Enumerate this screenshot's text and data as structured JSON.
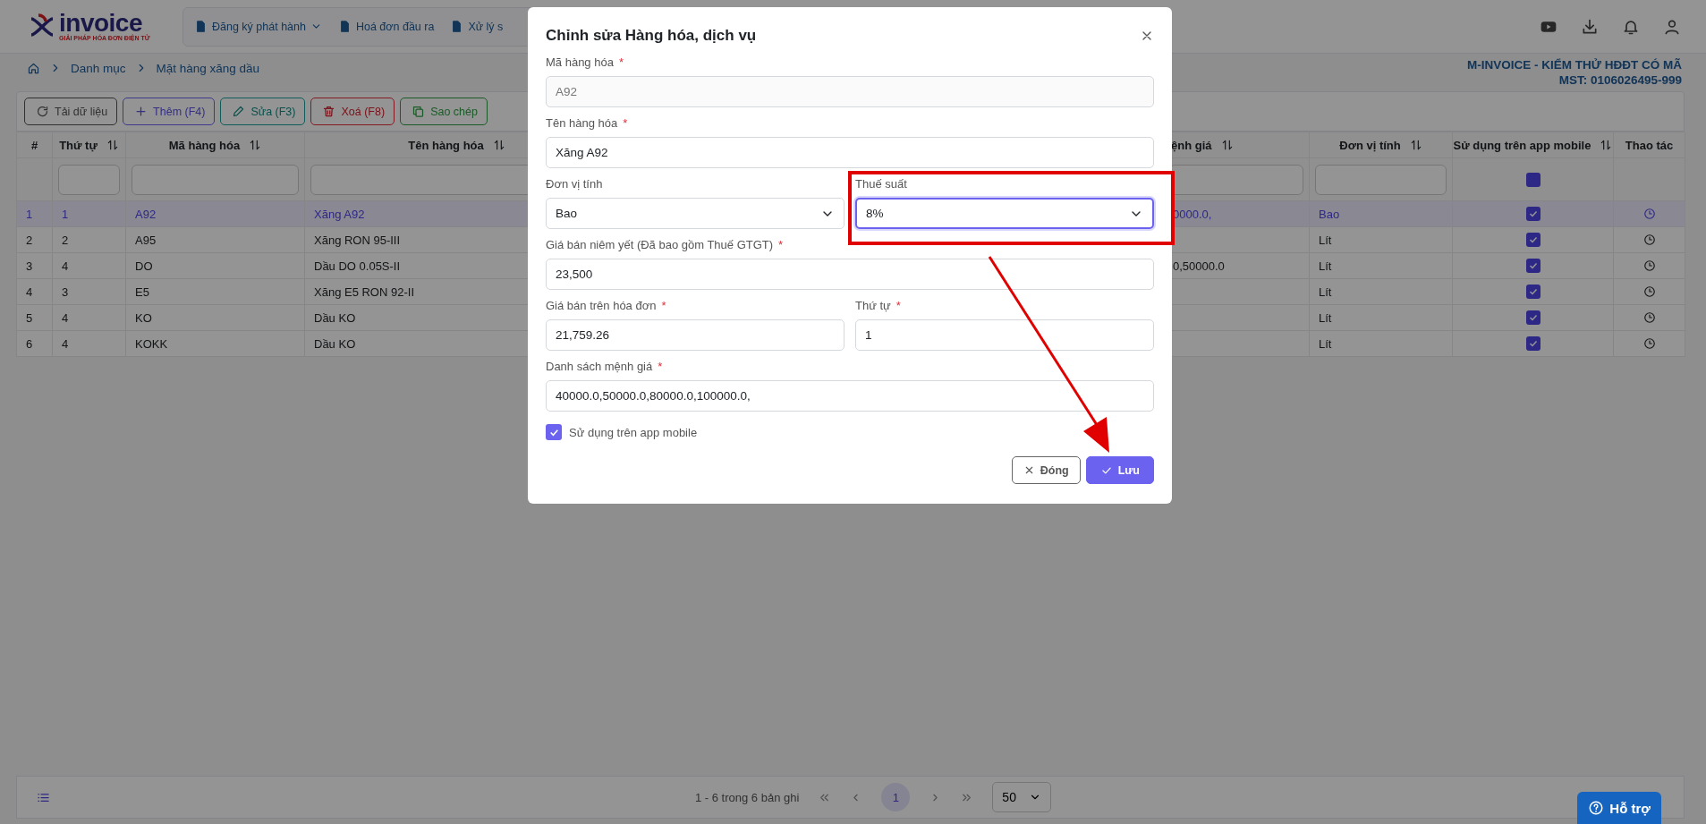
{
  "header": {
    "logo": {
      "text": "invoice",
      "tagline": "GIẢI PHÁP HÓA ĐƠN ĐIỆN TỬ"
    },
    "nav": [
      {
        "label": "Đăng ký phát hành",
        "dropdown": true
      },
      {
        "label": "Hoá đơn đầu ra",
        "dropdown": false
      },
      {
        "label": "Xử lý s",
        "dropdown": false
      }
    ]
  },
  "breadcrumb": [
    "Danh mục",
    "Mặt hàng xăng dầu"
  ],
  "company": {
    "name": "M-INVOICE - KIỂM THỬ HĐĐT CÓ MÃ",
    "tax_id": "MST: 0106026495-999"
  },
  "toolbar": [
    {
      "label": "Tải dữ liệu",
      "kind": "reload"
    },
    {
      "label": "Thêm (F4)",
      "kind": "add"
    },
    {
      "label": "Sửa (F3)",
      "kind": "edit"
    },
    {
      "label": "Xoá (F8)",
      "kind": "delete"
    },
    {
      "label": "Sao chép",
      "kind": "copy"
    }
  ],
  "table": {
    "columns": [
      {
        "label": "#",
        "kind": "text",
        "sortable": false,
        "filterable": false
      },
      {
        "label": "Thứ tự",
        "kind": "text",
        "sortable": true,
        "filterable": true
      },
      {
        "label": "Mã hàng hóa",
        "kind": "text",
        "sortable": true,
        "filterable": true
      },
      {
        "label": "Tên hàng hóa",
        "kind": "text",
        "sortable": true,
        "filterable": true
      },
      {
        "label": "ệnh giá",
        "kind": "text",
        "sortable": true,
        "filterable": true
      },
      {
        "label": "Đơn vị tính",
        "kind": "text",
        "sortable": true,
        "filterable": true
      },
      {
        "label": "Sử dụng trên app mobile",
        "kind": "checkbox",
        "sortable": true,
        "filterable": true,
        "filter_indeterminate": true
      },
      {
        "label": "Thao tác",
        "kind": "action",
        "sortable": false,
        "filterable": false
      }
    ],
    "rows": [
      {
        "cells": [
          "1",
          "1",
          "A92",
          "Xăng A92",
          "0000.0,",
          "Bao"
        ],
        "mobile": true,
        "selected": true
      },
      {
        "cells": [
          "2",
          "2",
          "A95",
          "Xăng RON 95-III",
          null,
          "Lít"
        ],
        "mobile": true,
        "selected": false
      },
      {
        "cells": [
          "3",
          "4",
          "DO",
          "Dầu DO 0.05S-II",
          "0,50000.0",
          "Lít"
        ],
        "mobile": true,
        "selected": false
      },
      {
        "cells": [
          "4",
          "3",
          "E5",
          "Xăng E5 RON 92-II",
          null,
          "Lít"
        ],
        "mobile": true,
        "selected": false
      },
      {
        "cells": [
          "5",
          "4",
          "KO",
          "Dầu KO",
          null,
          "Lít"
        ],
        "mobile": true,
        "selected": false
      },
      {
        "cells": [
          "6",
          "4",
          "KOKK",
          "Dầu KO",
          null,
          "Lít"
        ],
        "mobile": true,
        "selected": false
      }
    ]
  },
  "pagination": {
    "summary": "1 - 6 trong 6 bản ghi",
    "pages": [
      {
        "label": "1",
        "selected": true
      }
    ],
    "page_size": "50"
  },
  "help_button": {
    "label": "Hỗ trợ"
  },
  "modal": {
    "title": "Chỉnh sửa Hàng hóa, dịch vụ",
    "fields": [
      {
        "label": "Mã hàng hóa",
        "required_mark": "*",
        "kind": "input",
        "value": "A92",
        "full_width": true,
        "disabled": true
      },
      {
        "label": "Tên hàng hóa",
        "required_mark": "*",
        "kind": "input",
        "value": "Xăng A92",
        "full_width": true,
        "disabled": false
      },
      {
        "label": "Đơn vị tính",
        "kind": "select",
        "value": "Bao",
        "full_width": false,
        "focused": false
      },
      {
        "label": "Thuế suất",
        "kind": "select",
        "value": "8%",
        "full_width": false,
        "focused": true
      },
      {
        "label": "Giá bán niêm yết (Đã bao gồm Thuế GTGT)",
        "required_mark": "*",
        "kind": "input",
        "value": "23,500",
        "full_width": true,
        "disabled": false
      },
      {
        "label": "Giá bán trên hóa đơn",
        "required_mark": "*",
        "kind": "input",
        "value": "21,759.26",
        "full_width": false,
        "disabled": false
      },
      {
        "label": "Thứ tự",
        "required_mark": "*",
        "kind": "input",
        "value": "1",
        "full_width": false,
        "disabled": false
      },
      {
        "label": "Danh sách mệnh giá",
        "required_mark": "*",
        "kind": "input",
        "value": "40000.0,50000.0,80000.0,100000.0,",
        "full_width": true,
        "disabled": false
      }
    ],
    "checkbox": {
      "label": "Sử dụng trên app mobile",
      "checked": true
    },
    "buttons": [
      {
        "label": "Đóng",
        "kind": "close"
      },
      {
        "label": "Lưu",
        "kind": "save"
      }
    ]
  }
}
